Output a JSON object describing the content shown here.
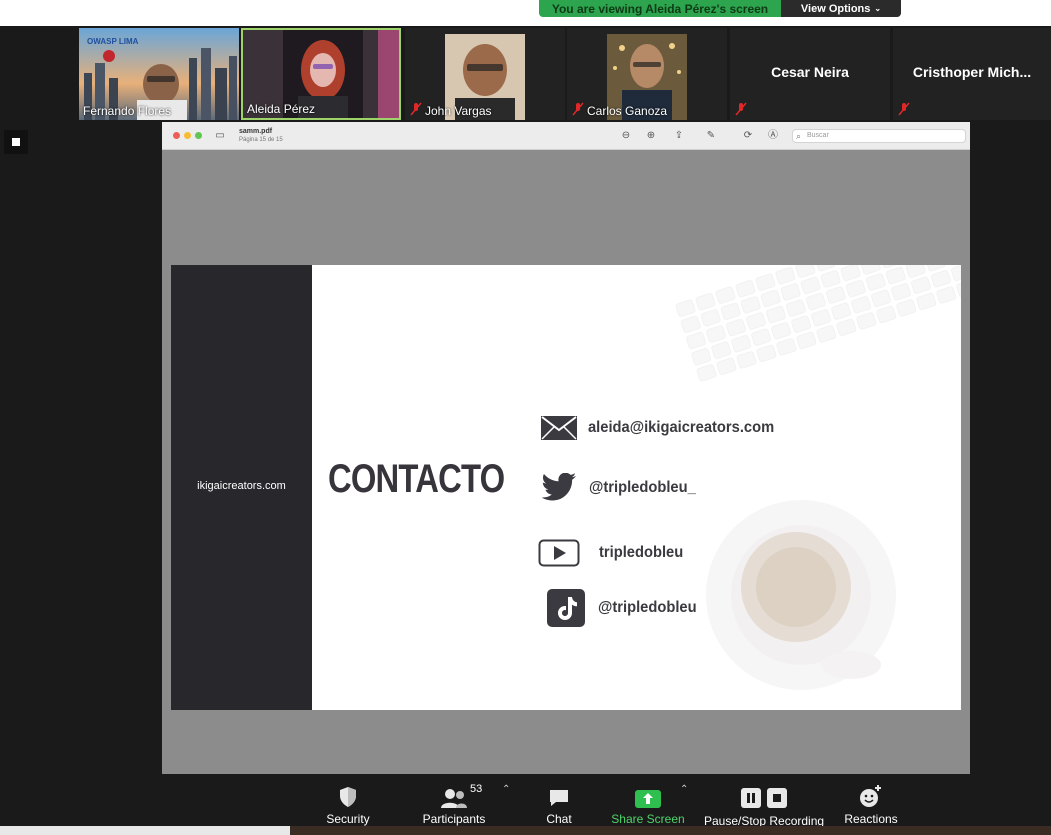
{
  "banner": {
    "viewing_text": "You are viewing Aleida Pérez's screen",
    "view_options_label": "View Options",
    "color_green": "#2da44e"
  },
  "participants": [
    {
      "name": "Fernando Flores",
      "muted": false,
      "overlay_text": "OWASP LIMA"
    },
    {
      "name": "Aleida Pérez",
      "muted": false,
      "active": true
    },
    {
      "name": "John Vargas",
      "muted": true
    },
    {
      "name": "Carlos Ganoza",
      "muted": true
    },
    {
      "name": "Cesar Neira",
      "muted": true,
      "no_video": true
    },
    {
      "name": "Cristhoper  Mich...",
      "muted": true,
      "no_video": true
    }
  ],
  "preview": {
    "filename": "samm.pdf",
    "page_info": "Página 15 de 15",
    "search_placeholder": "Buscar",
    "icons": [
      "zoom-out-icon",
      "zoom-in-icon",
      "share-icon",
      "markup-icon",
      "rotate-icon",
      "annotate-icon",
      "search-icon"
    ]
  },
  "slide": {
    "side_text": "ikigaicreators.com",
    "heading": "CONTACTO",
    "contacts": [
      {
        "icon": "email-icon",
        "text": "aleida@ikigaicreators.com"
      },
      {
        "icon": "twitter-icon",
        "text": "@tripledobleu_"
      },
      {
        "icon": "youtube-icon",
        "text": "tripledobleu"
      },
      {
        "icon": "tiktok-icon",
        "text": "@tripledobleu"
      }
    ]
  },
  "toolbar": {
    "security": "Security",
    "participants": "Participants",
    "participants_count": "53",
    "chat": "Chat",
    "share_screen": "Share Screen",
    "pause_recording": "Pause/Stop Recording",
    "reactions": "Reactions"
  }
}
